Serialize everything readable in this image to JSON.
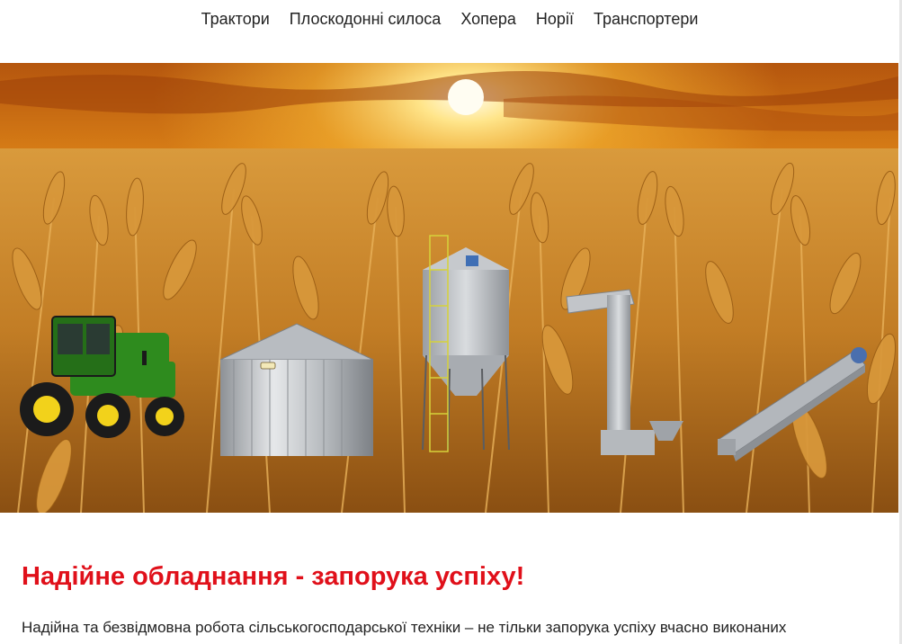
{
  "nav": {
    "items": [
      {
        "label": "Трактори"
      },
      {
        "label": "Плоскодонні силоса"
      },
      {
        "label": "Хопера"
      },
      {
        "label": "Норії"
      },
      {
        "label": "Транспортери"
      }
    ]
  },
  "hero": {
    "image": "wheat-field-sunset-with-agricultural-equipment",
    "equipment_icons": [
      "tractor-icon",
      "flat-bottom-silo-icon",
      "hopper-silo-icon",
      "bucket-elevator-icon",
      "conveyor-icon"
    ]
  },
  "content": {
    "headline": "Надійне обладнання - запорука успіху!",
    "paragraph": "Надійна та безвідмовна робота сільськогосподарської техніки – не тільки запорука успіху вчасно виконаних"
  },
  "colors": {
    "headline": "#e0101a",
    "text": "#222222",
    "sky": "#f5a623",
    "wheat": "#c98a2a",
    "tractor_green": "#2e8b1e",
    "tractor_yellow": "#f2d21b",
    "silo_metal": "#b9bcc0"
  }
}
